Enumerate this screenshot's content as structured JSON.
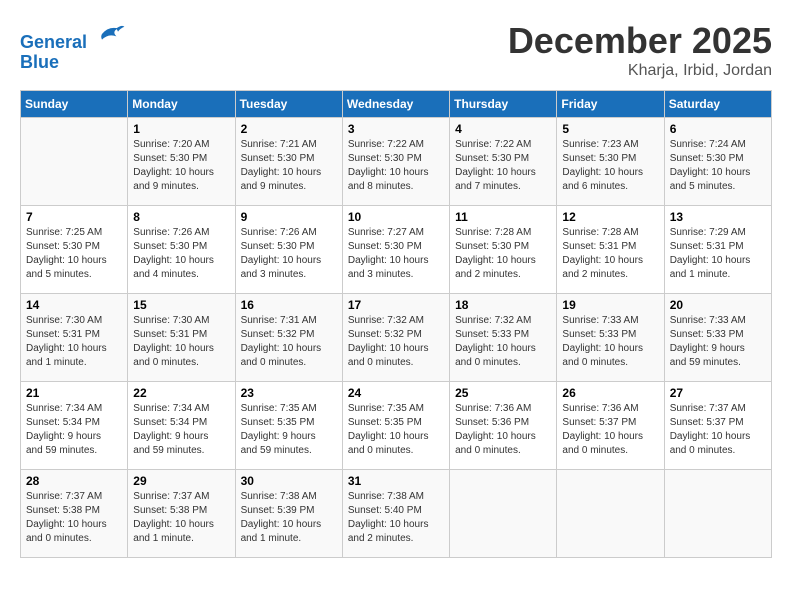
{
  "header": {
    "logo_line1": "General",
    "logo_line2": "Blue",
    "month": "December 2025",
    "location": "Kharja, Irbid, Jordan"
  },
  "days_of_week": [
    "Sunday",
    "Monday",
    "Tuesday",
    "Wednesday",
    "Thursday",
    "Friday",
    "Saturday"
  ],
  "weeks": [
    [
      {
        "day": "",
        "info": ""
      },
      {
        "day": "1",
        "info": "Sunrise: 7:20 AM\nSunset: 5:30 PM\nDaylight: 10 hours\nand 9 minutes."
      },
      {
        "day": "2",
        "info": "Sunrise: 7:21 AM\nSunset: 5:30 PM\nDaylight: 10 hours\nand 9 minutes."
      },
      {
        "day": "3",
        "info": "Sunrise: 7:22 AM\nSunset: 5:30 PM\nDaylight: 10 hours\nand 8 minutes."
      },
      {
        "day": "4",
        "info": "Sunrise: 7:22 AM\nSunset: 5:30 PM\nDaylight: 10 hours\nand 7 minutes."
      },
      {
        "day": "5",
        "info": "Sunrise: 7:23 AM\nSunset: 5:30 PM\nDaylight: 10 hours\nand 6 minutes."
      },
      {
        "day": "6",
        "info": "Sunrise: 7:24 AM\nSunset: 5:30 PM\nDaylight: 10 hours\nand 5 minutes."
      }
    ],
    [
      {
        "day": "7",
        "info": "Sunrise: 7:25 AM\nSunset: 5:30 PM\nDaylight: 10 hours\nand 5 minutes."
      },
      {
        "day": "8",
        "info": "Sunrise: 7:26 AM\nSunset: 5:30 PM\nDaylight: 10 hours\nand 4 minutes."
      },
      {
        "day": "9",
        "info": "Sunrise: 7:26 AM\nSunset: 5:30 PM\nDaylight: 10 hours\nand 3 minutes."
      },
      {
        "day": "10",
        "info": "Sunrise: 7:27 AM\nSunset: 5:30 PM\nDaylight: 10 hours\nand 3 minutes."
      },
      {
        "day": "11",
        "info": "Sunrise: 7:28 AM\nSunset: 5:30 PM\nDaylight: 10 hours\nand 2 minutes."
      },
      {
        "day": "12",
        "info": "Sunrise: 7:28 AM\nSunset: 5:31 PM\nDaylight: 10 hours\nand 2 minutes."
      },
      {
        "day": "13",
        "info": "Sunrise: 7:29 AM\nSunset: 5:31 PM\nDaylight: 10 hours\nand 1 minute."
      }
    ],
    [
      {
        "day": "14",
        "info": "Sunrise: 7:30 AM\nSunset: 5:31 PM\nDaylight: 10 hours\nand 1 minute."
      },
      {
        "day": "15",
        "info": "Sunrise: 7:30 AM\nSunset: 5:31 PM\nDaylight: 10 hours\nand 0 minutes."
      },
      {
        "day": "16",
        "info": "Sunrise: 7:31 AM\nSunset: 5:32 PM\nDaylight: 10 hours\nand 0 minutes."
      },
      {
        "day": "17",
        "info": "Sunrise: 7:32 AM\nSunset: 5:32 PM\nDaylight: 10 hours\nand 0 minutes."
      },
      {
        "day": "18",
        "info": "Sunrise: 7:32 AM\nSunset: 5:33 PM\nDaylight: 10 hours\nand 0 minutes."
      },
      {
        "day": "19",
        "info": "Sunrise: 7:33 AM\nSunset: 5:33 PM\nDaylight: 10 hours\nand 0 minutes."
      },
      {
        "day": "20",
        "info": "Sunrise: 7:33 AM\nSunset: 5:33 PM\nDaylight: 9 hours\nand 59 minutes."
      }
    ],
    [
      {
        "day": "21",
        "info": "Sunrise: 7:34 AM\nSunset: 5:34 PM\nDaylight: 9 hours\nand 59 minutes."
      },
      {
        "day": "22",
        "info": "Sunrise: 7:34 AM\nSunset: 5:34 PM\nDaylight: 9 hours\nand 59 minutes."
      },
      {
        "day": "23",
        "info": "Sunrise: 7:35 AM\nSunset: 5:35 PM\nDaylight: 9 hours\nand 59 minutes."
      },
      {
        "day": "24",
        "info": "Sunrise: 7:35 AM\nSunset: 5:35 PM\nDaylight: 10 hours\nand 0 minutes."
      },
      {
        "day": "25",
        "info": "Sunrise: 7:36 AM\nSunset: 5:36 PM\nDaylight: 10 hours\nand 0 minutes."
      },
      {
        "day": "26",
        "info": "Sunrise: 7:36 AM\nSunset: 5:37 PM\nDaylight: 10 hours\nand 0 minutes."
      },
      {
        "day": "27",
        "info": "Sunrise: 7:37 AM\nSunset: 5:37 PM\nDaylight: 10 hours\nand 0 minutes."
      }
    ],
    [
      {
        "day": "28",
        "info": "Sunrise: 7:37 AM\nSunset: 5:38 PM\nDaylight: 10 hours\nand 0 minutes."
      },
      {
        "day": "29",
        "info": "Sunrise: 7:37 AM\nSunset: 5:38 PM\nDaylight: 10 hours\nand 1 minute."
      },
      {
        "day": "30",
        "info": "Sunrise: 7:38 AM\nSunset: 5:39 PM\nDaylight: 10 hours\nand 1 minute."
      },
      {
        "day": "31",
        "info": "Sunrise: 7:38 AM\nSunset: 5:40 PM\nDaylight: 10 hours\nand 2 minutes."
      },
      {
        "day": "",
        "info": ""
      },
      {
        "day": "",
        "info": ""
      },
      {
        "day": "",
        "info": ""
      }
    ]
  ]
}
